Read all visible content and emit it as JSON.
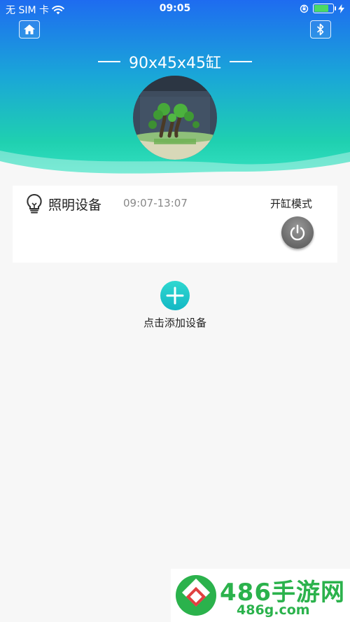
{
  "status_bar": {
    "carrier": "无 SIM 卡",
    "time": "09:05",
    "battery_level": 0.75,
    "icons": [
      "wifi-icon",
      "orientation-lock-icon",
      "battery-icon",
      "charging-icon"
    ]
  },
  "header": {
    "tank_name": "90x45x45缸",
    "home_icon": "home-icon",
    "bluetooth_icon": "bluetooth-icon"
  },
  "device_card": {
    "name": "照明设备",
    "schedule": "09:07-13:07",
    "mode_label": "开缸模式",
    "icons": [
      "lightbulb-icon",
      "power-icon"
    ]
  },
  "add_device": {
    "label": "点击添加设备",
    "icon": "plus-icon"
  },
  "watermark": {
    "title": "486手游网",
    "url": "486g.com"
  },
  "colors": {
    "header_top": "#1e6cf0",
    "header_bottom": "#3ee8c8",
    "accent": "#13b7c4",
    "watermark": "#2bb24c"
  }
}
